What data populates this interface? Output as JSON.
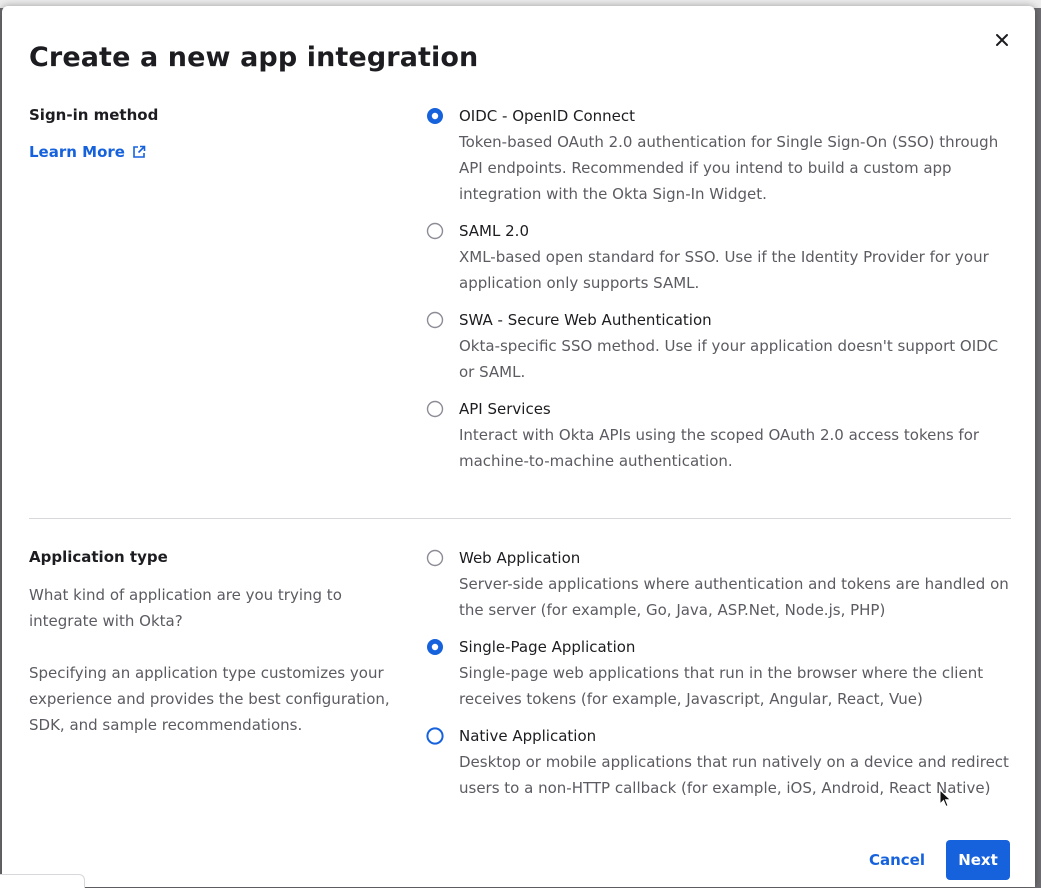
{
  "dialog": {
    "title": "Create a new app integration",
    "close_icon": "close-icon"
  },
  "sign_in": {
    "label": "Sign-in method",
    "learn_more": "Learn More",
    "learn_more_icon": "external-link-icon",
    "selected": "oidc",
    "options": [
      {
        "id": "oidc",
        "label": "OIDC - OpenID Connect",
        "description": "Token-based OAuth 2.0 authentication for Single Sign-On (SSO) through API endpoints. Recommended if you intend to build a custom app integration with the Okta Sign-In Widget."
      },
      {
        "id": "saml",
        "label": "SAML 2.0",
        "description": "XML-based open standard for SSO. Use if the Identity Provider for your application only supports SAML."
      },
      {
        "id": "swa",
        "label": "SWA - Secure Web Authentication",
        "description": "Okta-specific SSO method. Use if your application doesn't support OIDC or SAML."
      },
      {
        "id": "api",
        "label": "API Services",
        "description": "Interact with Okta APIs using the scoped OAuth 2.0 access tokens for machine-to-machine authentication."
      }
    ]
  },
  "app_type": {
    "label": "Application type",
    "question": "What kind of application are you trying to integrate with Okta?",
    "help": "Specifying an application type customizes your experience and provides the best configuration, SDK, and sample recommendations.",
    "selected": "spa",
    "focused": "native",
    "options": [
      {
        "id": "web",
        "label": "Web Application",
        "description": "Server-side applications where authentication and tokens are handled on the server (for example, Go, Java, ASP.Net, Node.js, PHP)"
      },
      {
        "id": "spa",
        "label": "Single-Page Application",
        "description": "Single-page web applications that run in the browser where the client receives tokens (for example, Javascript, Angular, React, Vue)"
      },
      {
        "id": "native",
        "label": "Native Application",
        "description": "Desktop or mobile applications that run natively on a device and redirect users to a non-HTTP callback (for example, iOS, Android, React Native)"
      }
    ]
  },
  "footer": {
    "cancel": "Cancel",
    "next": "Next"
  },
  "colors": {
    "accent": "#1662dd",
    "text": "#1d1d21",
    "muted": "#5b5b62"
  }
}
